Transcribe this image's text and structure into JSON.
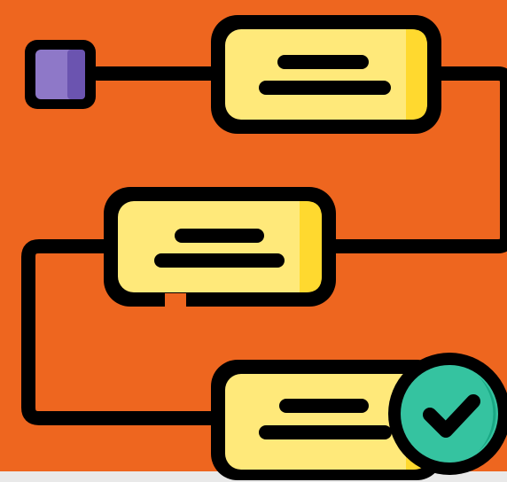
{
  "illustration": {
    "icon_name": "workflow-process-icon",
    "colors": {
      "background": "#ee661f",
      "bottom_strip": "#e9e9e9",
      "outline": "#000000",
      "card_fill": "#ffe97a",
      "card_shadow": "#ffd92f",
      "start_square": "#8e78c8",
      "start_square_shadow": "#6b54b0",
      "check_circle": "#35c3a0",
      "check_circle_shadow": "#19a884"
    },
    "cards": [
      {
        "id": "top-card",
        "lines": 2
      },
      {
        "id": "middle-card",
        "lines": 2
      },
      {
        "id": "bottom-card",
        "lines": 2
      }
    ],
    "start_node": "square-icon",
    "end_node": "checkmark-icon"
  }
}
